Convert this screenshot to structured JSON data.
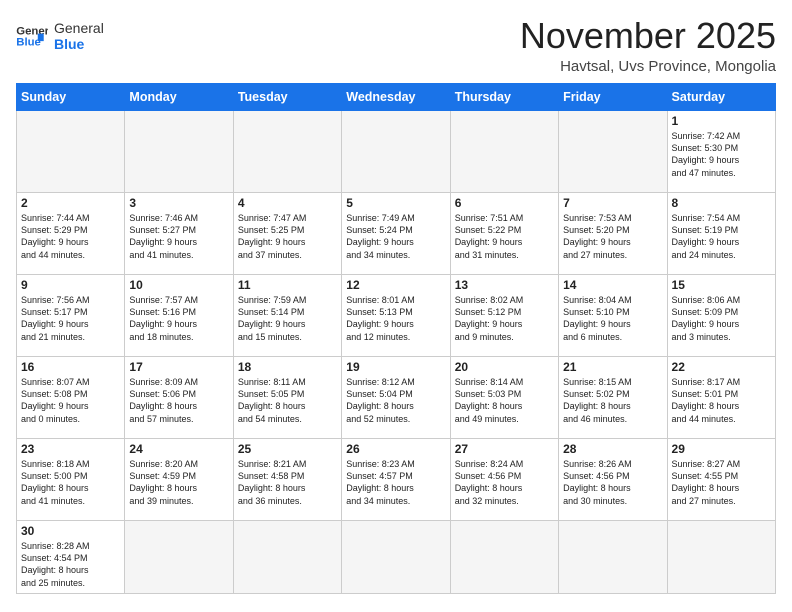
{
  "header": {
    "logo_general": "General",
    "logo_blue": "Blue",
    "month": "November 2025",
    "location": "Havtsal, Uvs Province, Mongolia"
  },
  "weekdays": [
    "Sunday",
    "Monday",
    "Tuesday",
    "Wednesday",
    "Thursday",
    "Friday",
    "Saturday"
  ],
  "weeks": [
    [
      {
        "day": "",
        "text": ""
      },
      {
        "day": "",
        "text": ""
      },
      {
        "day": "",
        "text": ""
      },
      {
        "day": "",
        "text": ""
      },
      {
        "day": "",
        "text": ""
      },
      {
        "day": "",
        "text": ""
      },
      {
        "day": "1",
        "text": "Sunrise: 7:42 AM\nSunset: 5:30 PM\nDaylight: 9 hours\nand 47 minutes."
      }
    ],
    [
      {
        "day": "2",
        "text": "Sunrise: 7:44 AM\nSunset: 5:29 PM\nDaylight: 9 hours\nand 44 minutes."
      },
      {
        "day": "3",
        "text": "Sunrise: 7:46 AM\nSunset: 5:27 PM\nDaylight: 9 hours\nand 41 minutes."
      },
      {
        "day": "4",
        "text": "Sunrise: 7:47 AM\nSunset: 5:25 PM\nDaylight: 9 hours\nand 37 minutes."
      },
      {
        "day": "5",
        "text": "Sunrise: 7:49 AM\nSunset: 5:24 PM\nDaylight: 9 hours\nand 34 minutes."
      },
      {
        "day": "6",
        "text": "Sunrise: 7:51 AM\nSunset: 5:22 PM\nDaylight: 9 hours\nand 31 minutes."
      },
      {
        "day": "7",
        "text": "Sunrise: 7:53 AM\nSunset: 5:20 PM\nDaylight: 9 hours\nand 27 minutes."
      },
      {
        "day": "8",
        "text": "Sunrise: 7:54 AM\nSunset: 5:19 PM\nDaylight: 9 hours\nand 24 minutes."
      }
    ],
    [
      {
        "day": "9",
        "text": "Sunrise: 7:56 AM\nSunset: 5:17 PM\nDaylight: 9 hours\nand 21 minutes."
      },
      {
        "day": "10",
        "text": "Sunrise: 7:57 AM\nSunset: 5:16 PM\nDaylight: 9 hours\nand 18 minutes."
      },
      {
        "day": "11",
        "text": "Sunrise: 7:59 AM\nSunset: 5:14 PM\nDaylight: 9 hours\nand 15 minutes."
      },
      {
        "day": "12",
        "text": "Sunrise: 8:01 AM\nSunset: 5:13 PM\nDaylight: 9 hours\nand 12 minutes."
      },
      {
        "day": "13",
        "text": "Sunrise: 8:02 AM\nSunset: 5:12 PM\nDaylight: 9 hours\nand 9 minutes."
      },
      {
        "day": "14",
        "text": "Sunrise: 8:04 AM\nSunset: 5:10 PM\nDaylight: 9 hours\nand 6 minutes."
      },
      {
        "day": "15",
        "text": "Sunrise: 8:06 AM\nSunset: 5:09 PM\nDaylight: 9 hours\nand 3 minutes."
      }
    ],
    [
      {
        "day": "16",
        "text": "Sunrise: 8:07 AM\nSunset: 5:08 PM\nDaylight: 9 hours\nand 0 minutes."
      },
      {
        "day": "17",
        "text": "Sunrise: 8:09 AM\nSunset: 5:06 PM\nDaylight: 8 hours\nand 57 minutes."
      },
      {
        "day": "18",
        "text": "Sunrise: 8:11 AM\nSunset: 5:05 PM\nDaylight: 8 hours\nand 54 minutes."
      },
      {
        "day": "19",
        "text": "Sunrise: 8:12 AM\nSunset: 5:04 PM\nDaylight: 8 hours\nand 52 minutes."
      },
      {
        "day": "20",
        "text": "Sunrise: 8:14 AM\nSunset: 5:03 PM\nDaylight: 8 hours\nand 49 minutes."
      },
      {
        "day": "21",
        "text": "Sunrise: 8:15 AM\nSunset: 5:02 PM\nDaylight: 8 hours\nand 46 minutes."
      },
      {
        "day": "22",
        "text": "Sunrise: 8:17 AM\nSunset: 5:01 PM\nDaylight: 8 hours\nand 44 minutes."
      }
    ],
    [
      {
        "day": "23",
        "text": "Sunrise: 8:18 AM\nSunset: 5:00 PM\nDaylight: 8 hours\nand 41 minutes."
      },
      {
        "day": "24",
        "text": "Sunrise: 8:20 AM\nSunset: 4:59 PM\nDaylight: 8 hours\nand 39 minutes."
      },
      {
        "day": "25",
        "text": "Sunrise: 8:21 AM\nSunset: 4:58 PM\nDaylight: 8 hours\nand 36 minutes."
      },
      {
        "day": "26",
        "text": "Sunrise: 8:23 AM\nSunset: 4:57 PM\nDaylight: 8 hours\nand 34 minutes."
      },
      {
        "day": "27",
        "text": "Sunrise: 8:24 AM\nSunset: 4:56 PM\nDaylight: 8 hours\nand 32 minutes."
      },
      {
        "day": "28",
        "text": "Sunrise: 8:26 AM\nSunset: 4:56 PM\nDaylight: 8 hours\nand 30 minutes."
      },
      {
        "day": "29",
        "text": "Sunrise: 8:27 AM\nSunset: 4:55 PM\nDaylight: 8 hours\nand 27 minutes."
      }
    ],
    [
      {
        "day": "30",
        "text": "Sunrise: 8:28 AM\nSunset: 4:54 PM\nDaylight: 8 hours\nand 25 minutes."
      },
      {
        "day": "",
        "text": ""
      },
      {
        "day": "",
        "text": ""
      },
      {
        "day": "",
        "text": ""
      },
      {
        "day": "",
        "text": ""
      },
      {
        "day": "",
        "text": ""
      },
      {
        "day": "",
        "text": ""
      }
    ]
  ]
}
